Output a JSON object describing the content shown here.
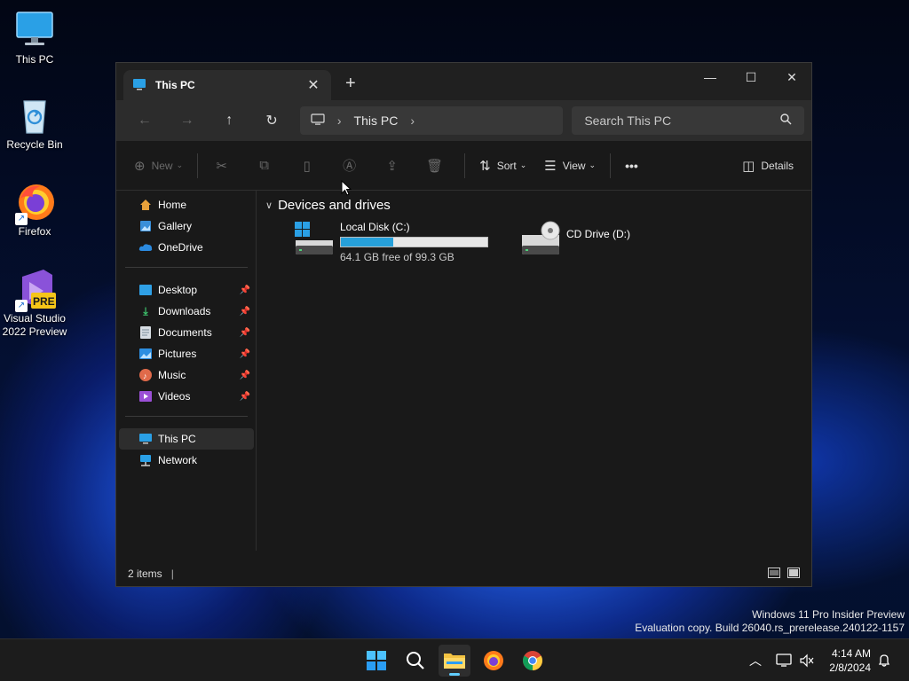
{
  "desktop": {
    "icons": [
      {
        "label": "This PC"
      },
      {
        "label": "Recycle Bin"
      },
      {
        "label": "Firefox"
      },
      {
        "label_line1": "Visual Studio",
        "label_line2": "2022 Preview",
        "badge": "PRE"
      }
    ],
    "watermark": {
      "line1": "Windows 11 Pro Insider Preview",
      "line2": "Evaluation copy. Build 26040.rs_prerelease.240122-1157"
    }
  },
  "window": {
    "tab": {
      "title": "This PC",
      "close_glyph": "✕"
    },
    "new_tab_glyph": "+",
    "controls": {
      "minimize": "—",
      "maximize": "☐",
      "close": "✕"
    },
    "nav": {
      "back": "←",
      "forward": "→",
      "up": "↑",
      "refresh": "↻"
    },
    "breadcrumb": {
      "location": "This PC",
      "separator": "›"
    },
    "search": {
      "placeholder": "Search This PC"
    },
    "commands": {
      "new_label": "New",
      "sort_label": "Sort",
      "view_label": "View",
      "more_label": "•••",
      "details_label": "Details"
    },
    "sidebar": {
      "top": [
        {
          "label": "Home",
          "icon": "home-icon"
        },
        {
          "label": "Gallery",
          "icon": "gallery-icon"
        },
        {
          "label": "OneDrive",
          "icon": "onedrive-icon"
        }
      ],
      "pinned": [
        {
          "label": "Desktop",
          "icon": "desktop-folder-icon"
        },
        {
          "label": "Downloads",
          "icon": "downloads-icon"
        },
        {
          "label": "Documents",
          "icon": "documents-icon"
        },
        {
          "label": "Pictures",
          "icon": "pictures-icon"
        },
        {
          "label": "Music",
          "icon": "music-icon"
        },
        {
          "label": "Videos",
          "icon": "videos-icon"
        }
      ],
      "bottom": [
        {
          "label": "This PC",
          "icon": "this-pc-icon",
          "selected": true
        },
        {
          "label": "Network",
          "icon": "network-icon"
        }
      ]
    },
    "main": {
      "group_title": "Devices and drives",
      "drives": [
        {
          "name": "Local Disk (C:)",
          "free_text": "64.1 GB free of 99.3 GB",
          "used_fraction": 0.355
        },
        {
          "name": "CD Drive (D:)"
        }
      ]
    },
    "status": {
      "items": "2 items"
    }
  },
  "taskbar": {
    "clock": {
      "time": "4:14 AM",
      "date": "2/8/2024"
    }
  },
  "colors": {
    "accent": "#60cdff",
    "progress": "#26a0da",
    "window_bg": "#191919"
  }
}
